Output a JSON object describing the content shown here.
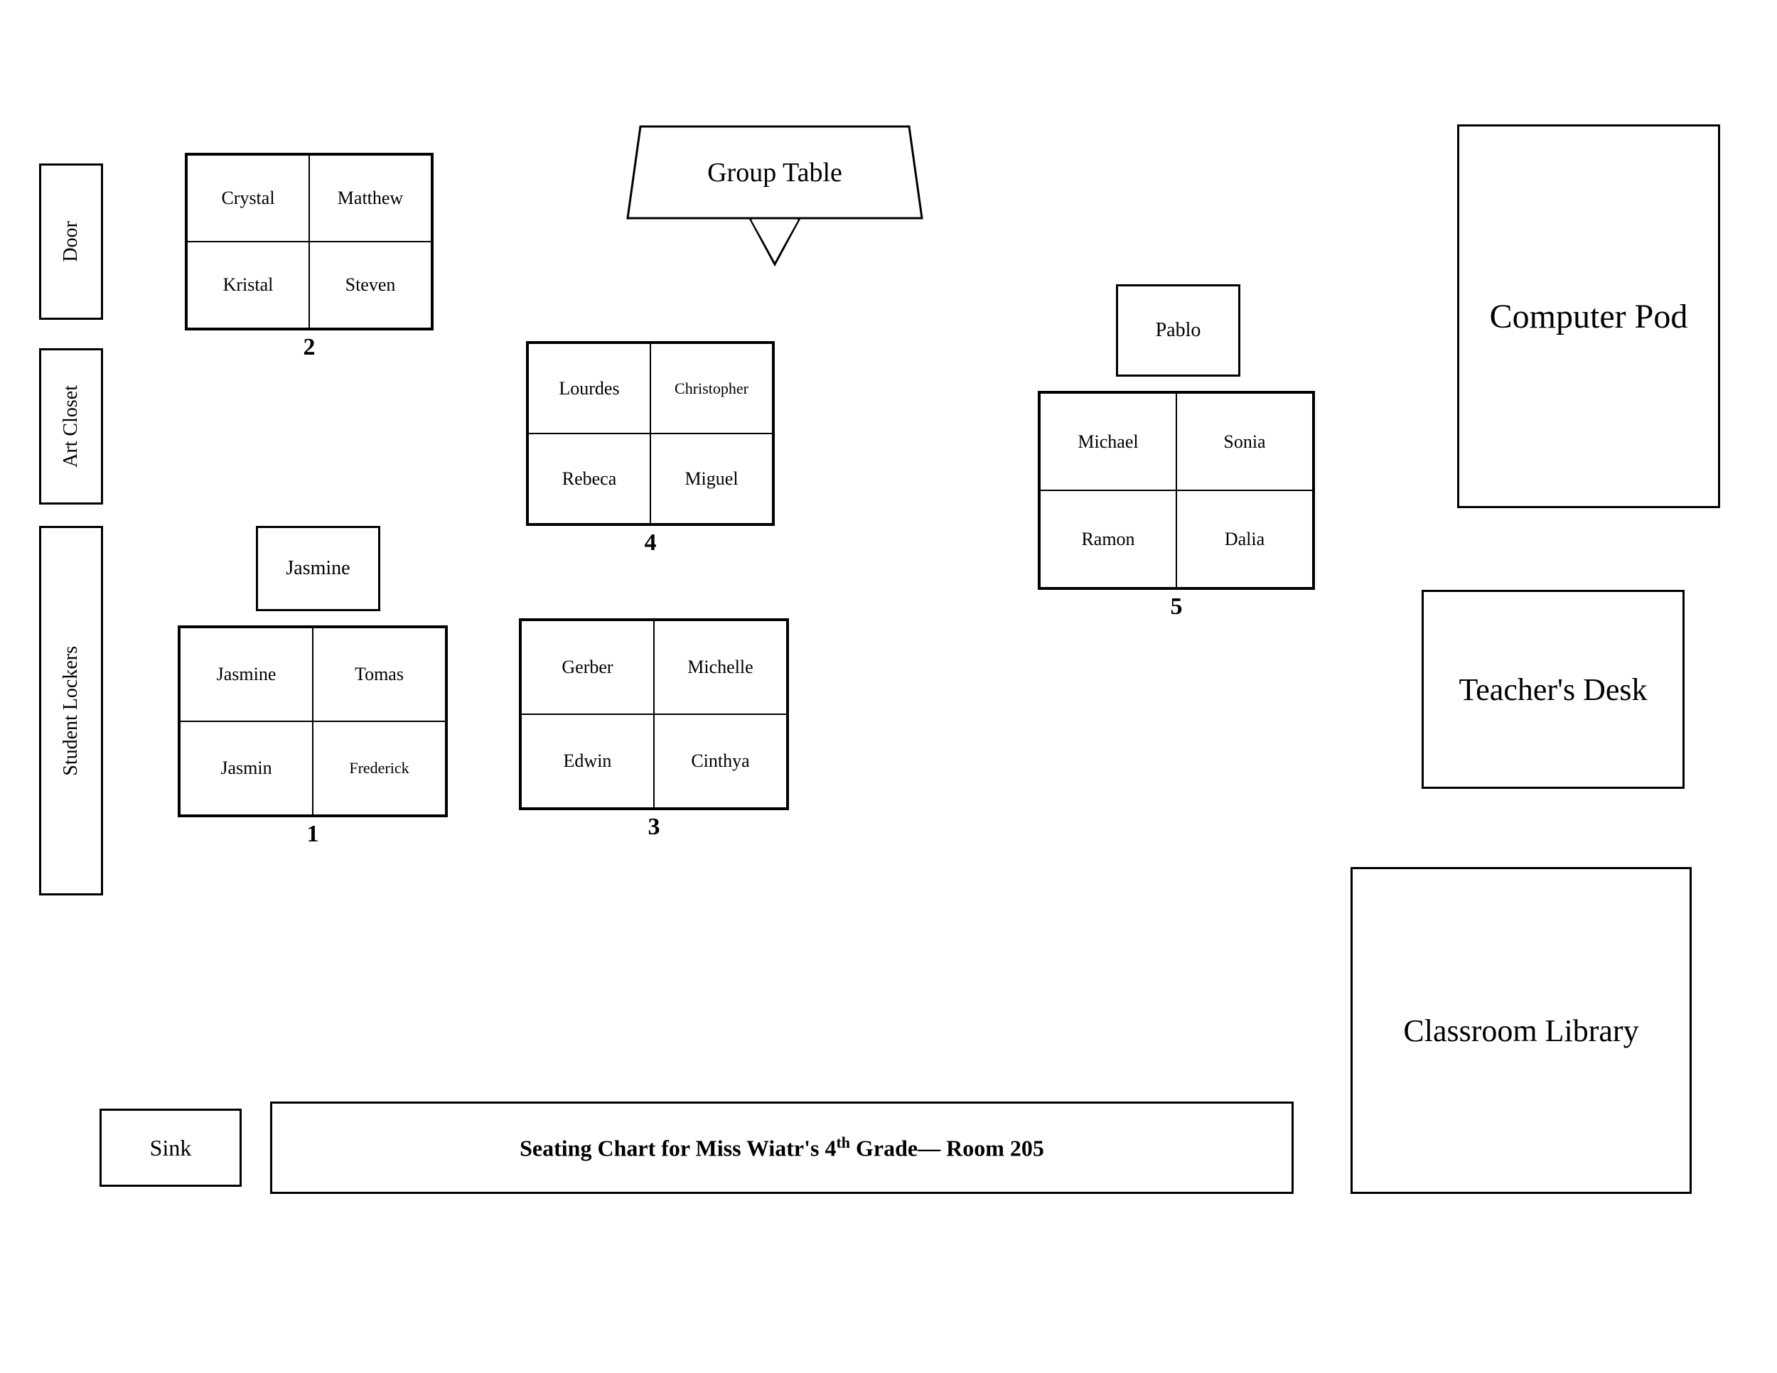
{
  "room": {
    "title": "Seating Chart for Miss Wiatr's 4",
    "title_sup": "th",
    "title_suffix": " Grade— Room 205"
  },
  "labels": {
    "door": "Door",
    "art_closet": "Art Closet",
    "student_lockers": "Student Lockers",
    "sink": "Sink",
    "computer_pod": "Computer Pod",
    "teachers_desk": "Teacher's Desk",
    "classroom_library": "Classroom Library",
    "group_table": "Group Table"
  },
  "groups": {
    "group1": {
      "number": "1",
      "jasmine_single": "Jasmine",
      "students": [
        "Jasmine",
        "Tomas",
        "Jasmin",
        "Frederick"
      ]
    },
    "group2": {
      "number": "2",
      "students": [
        "Crystal",
        "Matthew",
        "Kristal",
        "Steven"
      ]
    },
    "group3": {
      "number": "3",
      "students": [
        "Gerber",
        "Michelle",
        "Edwin",
        "Cinthya"
      ]
    },
    "group4": {
      "number": "4",
      "students": [
        "Lourdes",
        "Christopher",
        "Rebeca",
        "Miguel"
      ]
    },
    "group5": {
      "number": "5",
      "pablo_single": "Pablo",
      "students": [
        "Michael",
        "Sonia",
        "Ramon",
        "Dalia"
      ]
    }
  }
}
